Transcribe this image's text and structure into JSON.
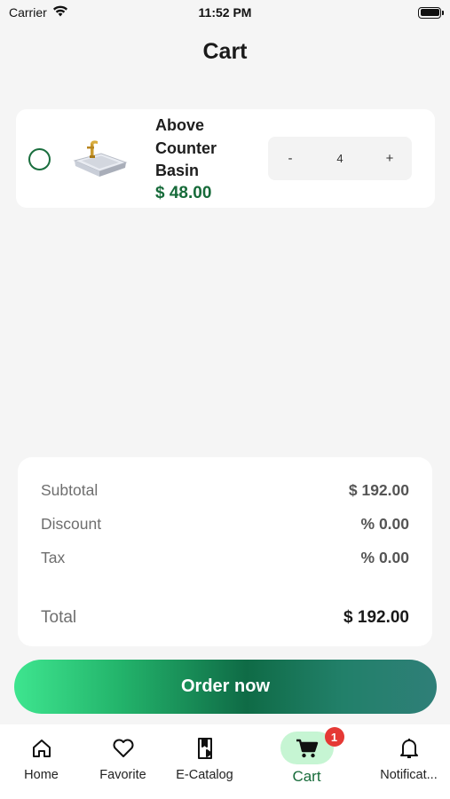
{
  "status_bar": {
    "carrier": "Carrier",
    "time": "11:52 PM"
  },
  "header": {
    "title": "Cart"
  },
  "cart_items": [
    {
      "name": "Above Counter Basin",
      "price": "$ 48.00",
      "quantity": "4",
      "decrement_label": "-",
      "increment_label": "+"
    }
  ],
  "summary": {
    "subtotal_label": "Subtotal",
    "subtotal_value": "$ 192.00",
    "discount_label": "Discount",
    "discount_value": "% 0.00",
    "tax_label": "Tax",
    "tax_value": "% 0.00",
    "total_label": "Total",
    "total_value": "$ 192.00"
  },
  "order_button": {
    "label": "Order now"
  },
  "bottom_nav": {
    "items": [
      {
        "label": "Home",
        "icon": "home-icon"
      },
      {
        "label": "Favorite",
        "icon": "heart-icon"
      },
      {
        "label": "E-Catalog",
        "icon": "catalog-icon"
      },
      {
        "label": "Cart",
        "icon": "cart-icon",
        "badge": "1",
        "active": true
      },
      {
        "label": "Notificat...",
        "icon": "bell-icon"
      }
    ]
  },
  "colors": {
    "accent_green": "#176b3a",
    "active_pill": "#c6f5d3",
    "badge_red": "#e53935"
  }
}
